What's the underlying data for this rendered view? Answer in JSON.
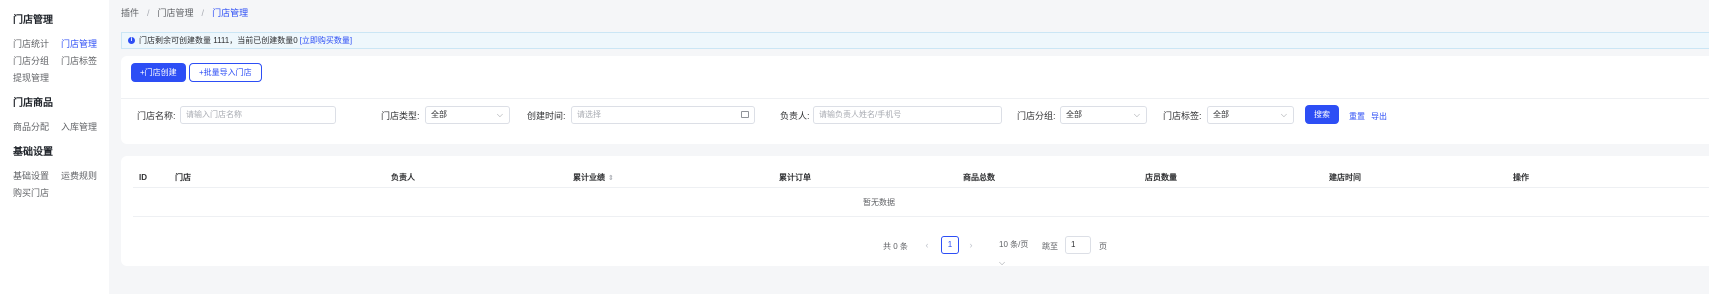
{
  "sidebar": {
    "groups": [
      {
        "title": "门店管理",
        "items": [
          {
            "label": "门店统计",
            "active": false
          },
          {
            "label": "门店管理",
            "active": true
          },
          {
            "label": "门店分组",
            "active": false
          },
          {
            "label": "门店标签",
            "active": false
          },
          {
            "label": "提现管理",
            "active": false
          }
        ]
      },
      {
        "title": "门店商品",
        "items": [
          {
            "label": "商品分配",
            "active": false
          },
          {
            "label": "入库管理",
            "active": false
          }
        ]
      },
      {
        "title": "基础设置",
        "items": [
          {
            "label": "基础设置",
            "active": false
          },
          {
            "label": "运费规则",
            "active": false
          },
          {
            "label": "购买门店",
            "active": false
          }
        ]
      }
    ]
  },
  "breadcrumb": {
    "items": [
      "插件",
      "门店管理",
      "门店管理"
    ],
    "separator": "/"
  },
  "notice": {
    "text": "门店剩余可创建数量 1111，当前已创建数量0",
    "link": "[立即购买数量]"
  },
  "actions": {
    "create": "+门店创建",
    "import": "+批量导入门店"
  },
  "filters": {
    "name_label": "门店名称:",
    "name_placeholder": "请输入门店名称",
    "type_label": "门店类型:",
    "type_value": "全部",
    "time_label": "创建时间:",
    "time_placeholder": "请选择",
    "owner_label": "负责人:",
    "owner_placeholder": "请输负责人姓名/手机号",
    "group_label": "门店分组:",
    "group_value": "全部",
    "tag_label": "门店标签:",
    "tag_value": "全部",
    "search": "搜索",
    "reset": "重置",
    "export": "导出"
  },
  "table": {
    "columns": [
      "ID",
      "门店",
      "负责人",
      "累计业绩",
      "累计订单",
      "商品总数",
      "店员数量",
      "建店时间",
      "操作"
    ],
    "sortable_column": "累计业绩",
    "empty_text": "暂无数据"
  },
  "pagination": {
    "total": "共 0 条",
    "current_page": "1",
    "page_size": "10 条/页",
    "jump_label": "跳至",
    "jump_value": "1",
    "page_label": "页"
  },
  "colors": {
    "primary": "#2d4ef5",
    "notice_bg": "#eef7fc",
    "page_bg": "#f5f6f8"
  }
}
